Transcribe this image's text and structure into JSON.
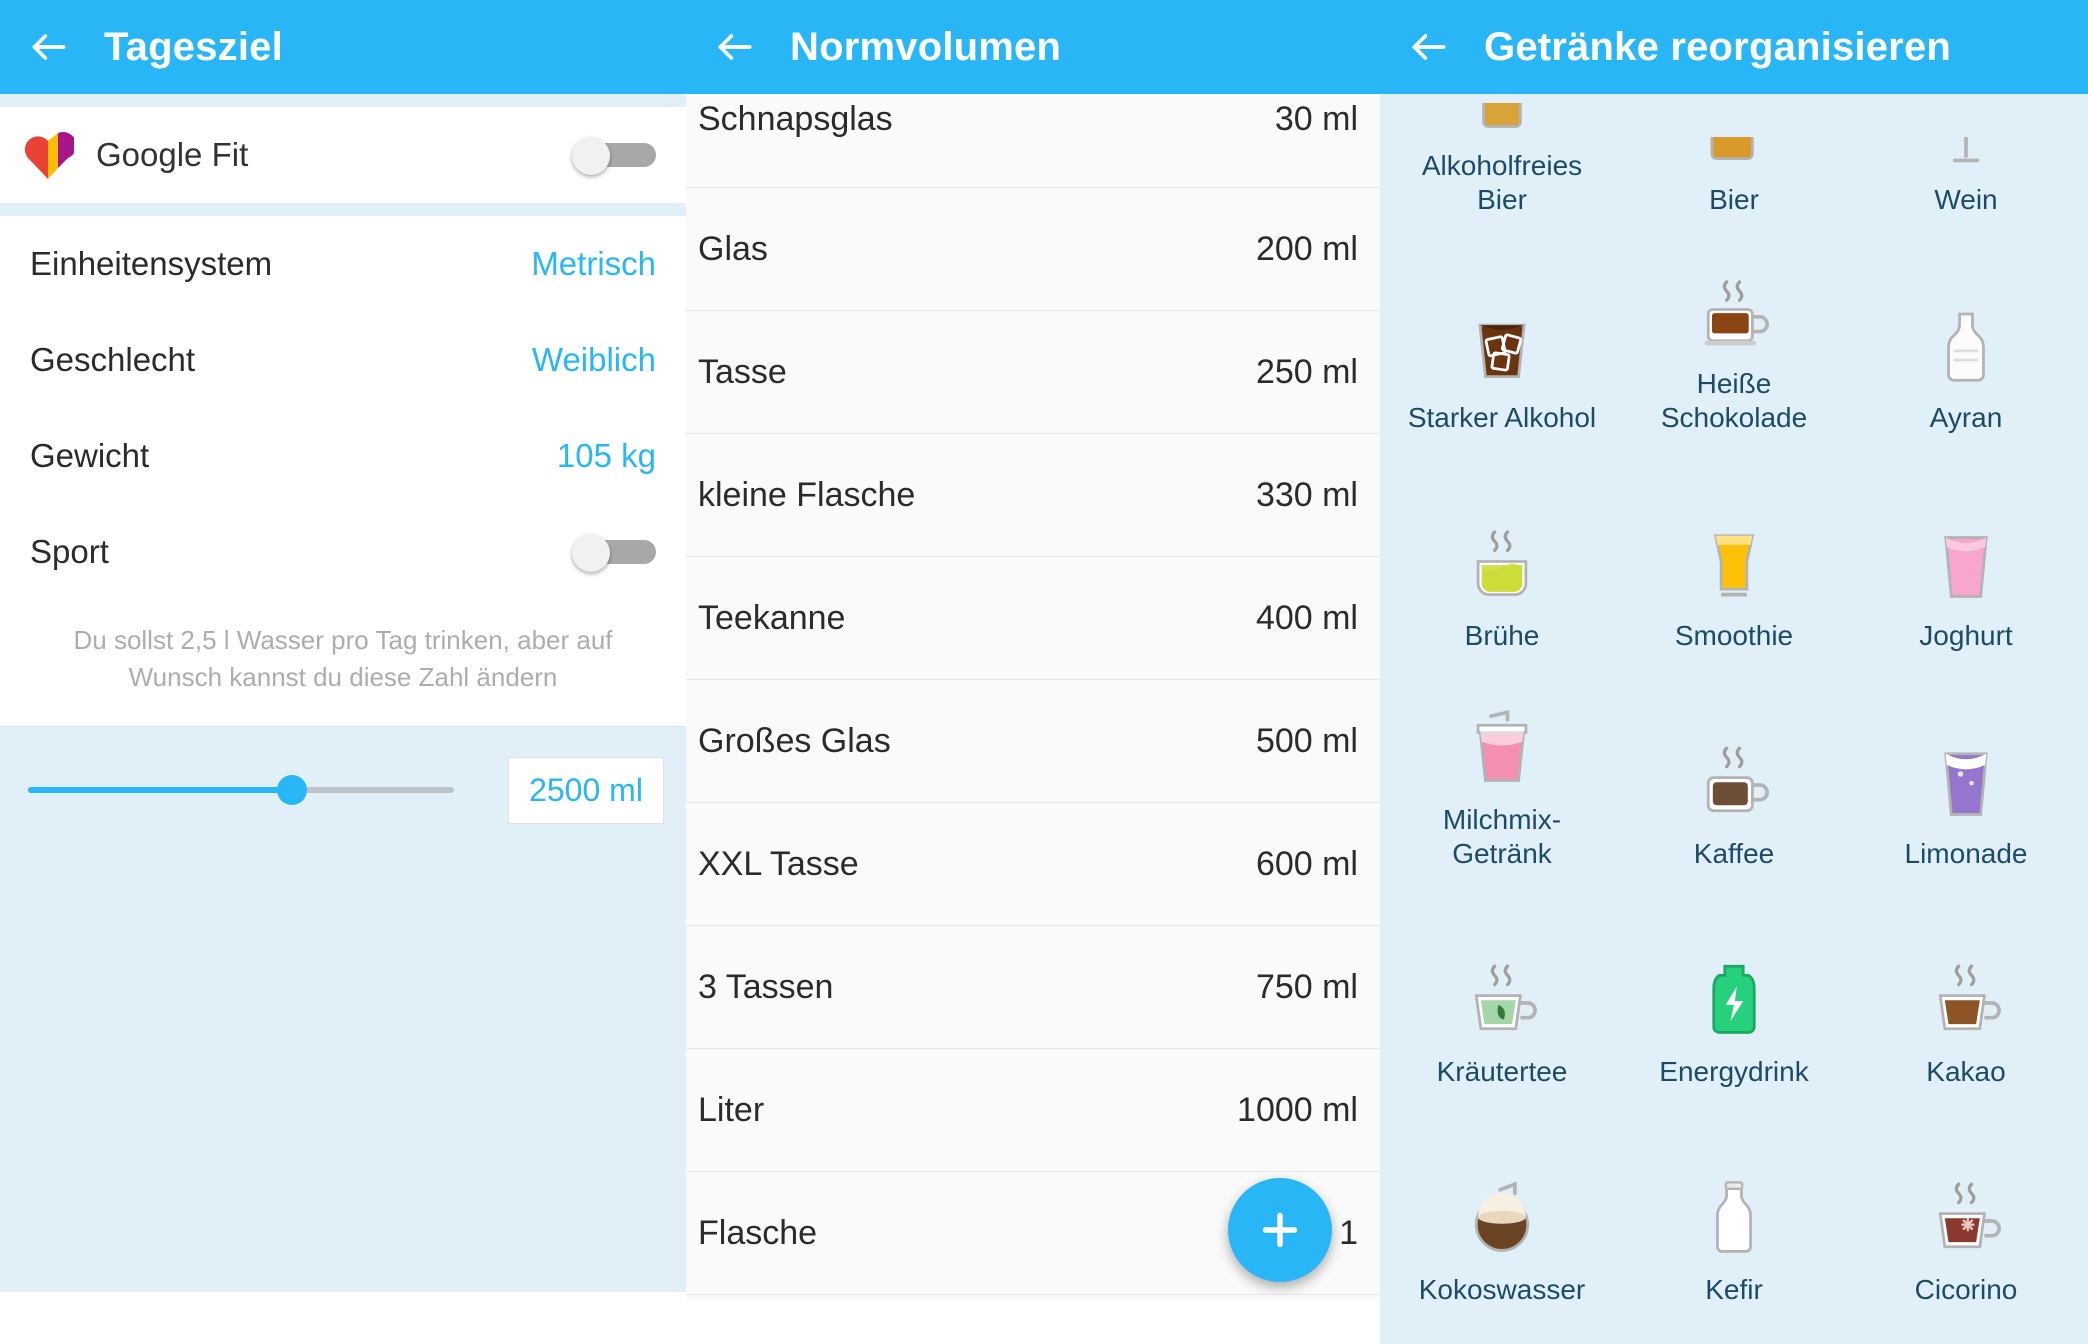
{
  "panel_daily_goal": {
    "title": "Tagesziel",
    "back_icon": "back-arrow-icon",
    "google_fit": {
      "label": "Google Fit",
      "icon": "google-fit-heart-icon",
      "toggle_state": "off"
    },
    "settings": [
      {
        "label": "Einheitensystem",
        "value": "Metrisch",
        "type": "value"
      },
      {
        "label": "Geschlecht",
        "value": "Weiblich",
        "type": "value"
      },
      {
        "label": "Gewicht",
        "value": "105 kg",
        "type": "value"
      },
      {
        "label": "Sport",
        "value": "",
        "type": "toggle",
        "toggle_state": "off"
      }
    ],
    "hint": "Du sollst 2,5 l Wasser pro Tag trinken, aber auf Wunsch kannst du diese Zahl ändern",
    "slider": {
      "value_label": "2500 ml",
      "percent": 62
    },
    "accent_color": "#29b6f6"
  },
  "panel_norm_volume": {
    "title": "Normvolumen",
    "back_icon": "back-arrow-icon",
    "add_button_icon": "plus-icon",
    "rows": [
      {
        "name": "Schnapsglas",
        "volume": "30 ml"
      },
      {
        "name": "Glas",
        "volume": "200 ml"
      },
      {
        "name": "Tasse",
        "volume": "250 ml"
      },
      {
        "name": "kleine Flasche",
        "volume": "330 ml"
      },
      {
        "name": "Teekanne",
        "volume": "400 ml"
      },
      {
        "name": "Großes Glas",
        "volume": "500 ml"
      },
      {
        "name": "XXL Tasse",
        "volume": "600 ml"
      },
      {
        "name": "3 Tassen",
        "volume": "750 ml"
      },
      {
        "name": "Liter",
        "volume": "1000 ml"
      },
      {
        "name": "Flasche",
        "volume": "1"
      }
    ]
  },
  "panel_reorganize_drinks": {
    "title": "Getränke reorganisieren",
    "back_icon": "back-arrow-icon",
    "drinks": [
      {
        "label": "Alkoholfreies Bier",
        "icon": "beer-glass-icon",
        "clipped": true
      },
      {
        "label": "Bier",
        "icon": "beer-mug-icon",
        "clipped": true
      },
      {
        "label": "Wein",
        "icon": "wine-glass-icon",
        "clipped": true
      },
      {
        "label": "Starker Alkohol",
        "icon": "whisky-glass-ice-icon",
        "clipped": false
      },
      {
        "label": "Heiße Schokolade",
        "icon": "hot-chocolate-cup-icon",
        "clipped": false
      },
      {
        "label": "Ayran",
        "icon": "bottle-white-icon",
        "clipped": false
      },
      {
        "label": "Brühe",
        "icon": "broth-bowl-icon",
        "clipped": false
      },
      {
        "label": "Smoothie",
        "icon": "smoothie-glass-icon",
        "clipped": false
      },
      {
        "label": "Joghurt",
        "icon": "yogurt-glass-icon",
        "clipped": false
      },
      {
        "label": "Milchmix-Getränk",
        "icon": "milkshake-cup-icon",
        "clipped": false
      },
      {
        "label": "Kaffee",
        "icon": "coffee-cup-icon",
        "clipped": false
      },
      {
        "label": "Limonade",
        "icon": "soda-glass-icon",
        "clipped": false
      },
      {
        "label": "Kräutertee",
        "icon": "herbal-tea-cup-icon",
        "clipped": false
      },
      {
        "label": "Energydrink",
        "icon": "energy-drink-icon",
        "clipped": false
      },
      {
        "label": "Kakao",
        "icon": "cocoa-cup-icon",
        "clipped": false
      },
      {
        "label": "Kokoswasser",
        "icon": "coconut-water-icon",
        "clipped": false
      },
      {
        "label": "Kefir",
        "icon": "milk-bottle-icon",
        "clipped": false
      },
      {
        "label": "Cicorino",
        "icon": "chicory-cup-icon",
        "clipped": false
      }
    ]
  }
}
